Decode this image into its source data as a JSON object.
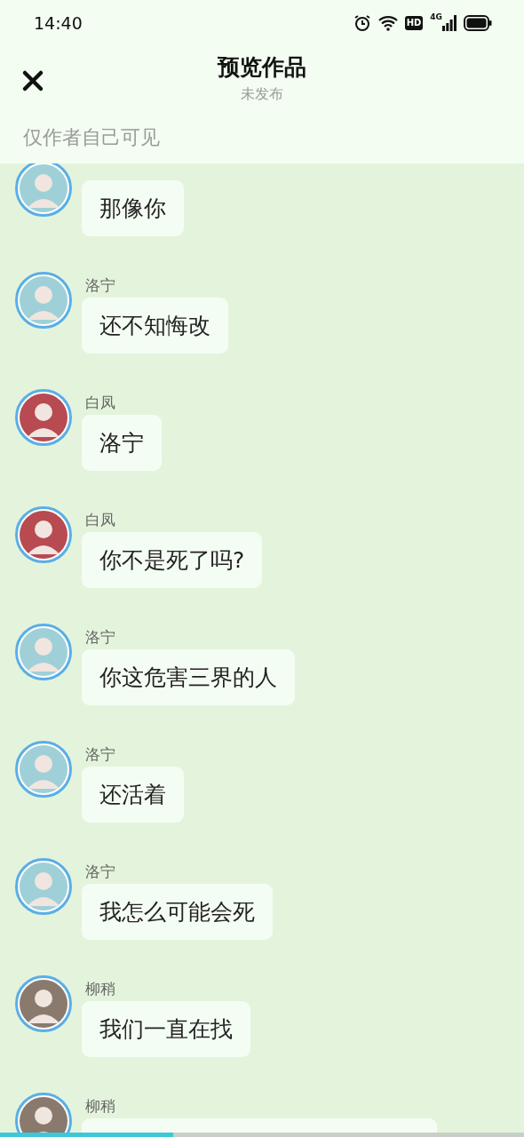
{
  "status_bar": {
    "time": "14:40",
    "hd": "HD",
    "network": "4G"
  },
  "header": {
    "title": "预览作品",
    "subtitle": "未发布"
  },
  "notice": "仅作者自己可见",
  "messages": [
    {
      "text": "那像你",
      "color": "#9fd0d8"
    },
    {
      "name": "洛宁",
      "text": "还不知悔改",
      "color": "#9fd0d8"
    },
    {
      "name": "白凤",
      "text": "洛宁",
      "color": "#b84a52"
    },
    {
      "name": "白凤",
      "text": "你不是死了吗?",
      "color": "#b84a52"
    },
    {
      "name": "洛宁",
      "text": "你这危害三界的人",
      "color": "#9fd0d8"
    },
    {
      "name": "洛宁",
      "text": "还活着",
      "color": "#9fd0d8"
    },
    {
      "name": "洛宁",
      "text": "我怎么可能会死",
      "color": "#9fd0d8"
    },
    {
      "name": "柳稍",
      "text": "我们一直在找",
      "color": "#8a7a6e"
    },
    {
      "name": "柳稍",
      "color": "#8a7a6e"
    }
  ],
  "progress": {
    "level": 0.33
  }
}
